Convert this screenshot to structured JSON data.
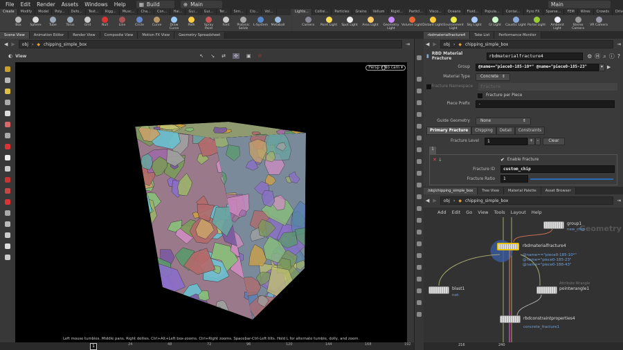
{
  "menu": {
    "items": [
      "File",
      "Edit",
      "Render",
      "Assets",
      "Windows",
      "Help"
    ],
    "desktop": "Build",
    "context": "Main",
    "context2": "Main"
  },
  "shelf_left": {
    "tabs": [
      "Create",
      "Modify",
      "Model",
      "Poly...",
      "Defo...",
      "Text...",
      "Rigg...",
      "Musc...",
      "Cha...",
      "Con...",
      "Hai...",
      "Gui...",
      "Gui...",
      "Ter...",
      "Sim...",
      "Clo...",
      "Vol..."
    ],
    "tools": [
      "Box",
      "Sphere",
      "Tube",
      "Torus",
      "Grid",
      "Null",
      "Line",
      "Circle",
      "Curve",
      "Draw Curve",
      "Path",
      "Spray Paint",
      "Font",
      "Platonic Solids",
      "L-System",
      "Metaball"
    ]
  },
  "shelf_right": {
    "tabs": [
      "Lights...",
      "Collisi...",
      "Particles",
      "Grains",
      "Vellum",
      "Rigid...",
      "Particl...",
      "Visco...",
      "Oceans",
      "Fluid...",
      "Popula...",
      "Contai...",
      "Pyro FX",
      "Sparse...",
      "FEM",
      "Wires",
      "Crowds",
      "Drive..."
    ],
    "tools": [
      "Camera",
      "Point Light",
      "Spot Light",
      "Area Light",
      "Geometry Light",
      "Volume Light",
      "Distant Light",
      "Environment Light",
      "Sky Light",
      "GI Light",
      "Caustic Light",
      "Portal Light",
      "Ambient Light",
      "Stereo Camera",
      "VR Camera"
    ]
  },
  "left_tabs": [
    "Scene View",
    "Animation Editor",
    "Render View",
    "Composite View",
    "Motion FX View",
    "Geometry Spreadsheet"
  ],
  "path": {
    "root": "obj",
    "node": "chipping_simple_box"
  },
  "viewport": {
    "title": "View",
    "persp": "Persp",
    "cam": "No cam",
    "hint": "Left mouse tumbles. Middle pans. Right dollies. Ctrl+Alt+Left box-zooms. Ctrl+Right zooms. Spacebar-Ctrl-Left tilts. Hold L for alternate tumble, dolly, and zoom."
  },
  "timeline": {
    "frame": "1",
    "ticks": [
      "24",
      "48",
      "72",
      "96",
      "120",
      "144",
      "168",
      "192"
    ]
  },
  "params": {
    "tabs": [
      "rbdmaterialfracture4",
      "Take List",
      "Performance Monitor"
    ],
    "node_type": "RBD Material Fracture",
    "node_name": "rbdmaterialfracture4",
    "group_label": "Group",
    "group": "@name==\"piece0-185-10*\" @name=\"piece0-185-23\"",
    "material_label": "Material Type",
    "material": "Concrete",
    "namespace_label": "Fracture Namespace",
    "namespace_placeholder": "fracture",
    "per_piece_label": "Fracture per Piece",
    "prefix_label": "Piece Prefix",
    "prefix": "-",
    "guide_label": "Guide Geometry",
    "guide": "None",
    "subtabs": [
      "Primary Fracture",
      "Chipping",
      "Detail",
      "Constraints"
    ],
    "level_label": "Fracture Level",
    "level": "1",
    "clear": "Clear",
    "plus": "+",
    "minus": "-",
    "multiparm_tab": "1",
    "enable_label": "Enable Fracture",
    "id_label": "Fracture ID",
    "id": "custom_chip",
    "ratio_label": "Fracture Ratio",
    "ratio": "1"
  },
  "network": {
    "tabs": [
      "/obj/chipping_simple_box",
      "Tree View",
      "Material Palette",
      "Asset Browser"
    ],
    "menu": [
      "Add",
      "Edit",
      "Go",
      "View",
      "Tools",
      "Layout",
      "Help"
    ],
    "watermark": "Geometry",
    "nodes": {
      "group1": {
        "name": "group1",
        "sub": "new_chip"
      },
      "rbd": {
        "name": "rbdmaterialfracture4",
        "sub": [
          "@name==\"piece0-185-10*\"",
          "@name=\"piece0-185-23\"",
          "@name=\"piece0-188-43\""
        ]
      },
      "blast": {
        "name": "blast1",
        "sub": "not:"
      },
      "wrangle": {
        "name": "pointwrangle1",
        "type": "Attribute Wrangle"
      },
      "constraint": {
        "name": "rbdconstraintproperties4",
        "sub": "concrete_fracture1"
      }
    },
    "ruler": [
      "216",
      "240"
    ]
  }
}
